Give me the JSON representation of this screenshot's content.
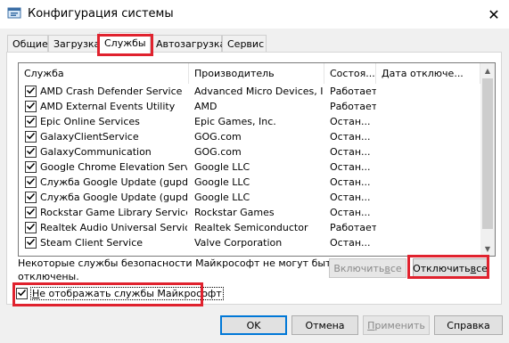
{
  "window": {
    "title": "Конфигурация системы",
    "close_glyph": "✕",
    "icon": "msconfig-icon"
  },
  "tabs": [
    {
      "label": "Общие",
      "active": false
    },
    {
      "label": "Загрузка",
      "active": false
    },
    {
      "label": "Службы",
      "active": true
    },
    {
      "label": "Автозагрузка",
      "active": false
    },
    {
      "label": "Сервис",
      "active": false
    }
  ],
  "services_table": {
    "columns": [
      "Служба",
      "Производитель",
      "Состоя...",
      "Дата отключе..."
    ],
    "rows": [
      {
        "checked": true,
        "name": "AMD Crash Defender Service",
        "vendor": "Advanced Micro Devices, I...",
        "status": "Работает",
        "date": ""
      },
      {
        "checked": true,
        "name": "AMD External Events Utility",
        "vendor": "AMD",
        "status": "Работает",
        "date": ""
      },
      {
        "checked": true,
        "name": "Epic Online Services",
        "vendor": "Epic Games, Inc.",
        "status": "Остан...",
        "date": ""
      },
      {
        "checked": true,
        "name": "GalaxyClientService",
        "vendor": "GOG.com",
        "status": "Остан...",
        "date": ""
      },
      {
        "checked": true,
        "name": "GalaxyCommunication",
        "vendor": "GOG.com",
        "status": "Остан...",
        "date": ""
      },
      {
        "checked": true,
        "name": "Google Chrome Elevation Servic...",
        "vendor": "Google LLC",
        "status": "Остан...",
        "date": ""
      },
      {
        "checked": true,
        "name": "Служба Google Update (gupdate)",
        "vendor": "Google LLC",
        "status": "Остан...",
        "date": ""
      },
      {
        "checked": true,
        "name": "Служба Google Update (gupdat...",
        "vendor": "Google LLC",
        "status": "Остан...",
        "date": ""
      },
      {
        "checked": true,
        "name": "Rockstar Game Library Service",
        "vendor": "Rockstar Games",
        "status": "Остан...",
        "date": ""
      },
      {
        "checked": true,
        "name": "Realtek Audio Universal Service",
        "vendor": "Realtek Semiconductor",
        "status": "Работает",
        "date": ""
      },
      {
        "checked": true,
        "name": "Steam Client Service",
        "vendor": "Valve Corporation",
        "status": "Остан...",
        "date": ""
      }
    ]
  },
  "note": {
    "text": "Некоторые службы безопасности Майкрософт не могут быть отключены."
  },
  "buttons": {
    "enable_all_prefix": "Включить ",
    "enable_all_mnemonic": "в",
    "enable_all_suffix": "се",
    "disable_all_prefix": "Отключить ",
    "disable_all_mnemonic": "в",
    "disable_all_suffix": "се",
    "ok": "OK",
    "cancel": "Отмена",
    "apply_mnemonic": "П",
    "apply_rest": "рименить",
    "help": "Справка"
  },
  "hide_ms_checkbox": {
    "checked": true,
    "mnemonic": "Н",
    "rest": "е отображать службы Майкрософт"
  },
  "highlight_color": "#e0222e"
}
